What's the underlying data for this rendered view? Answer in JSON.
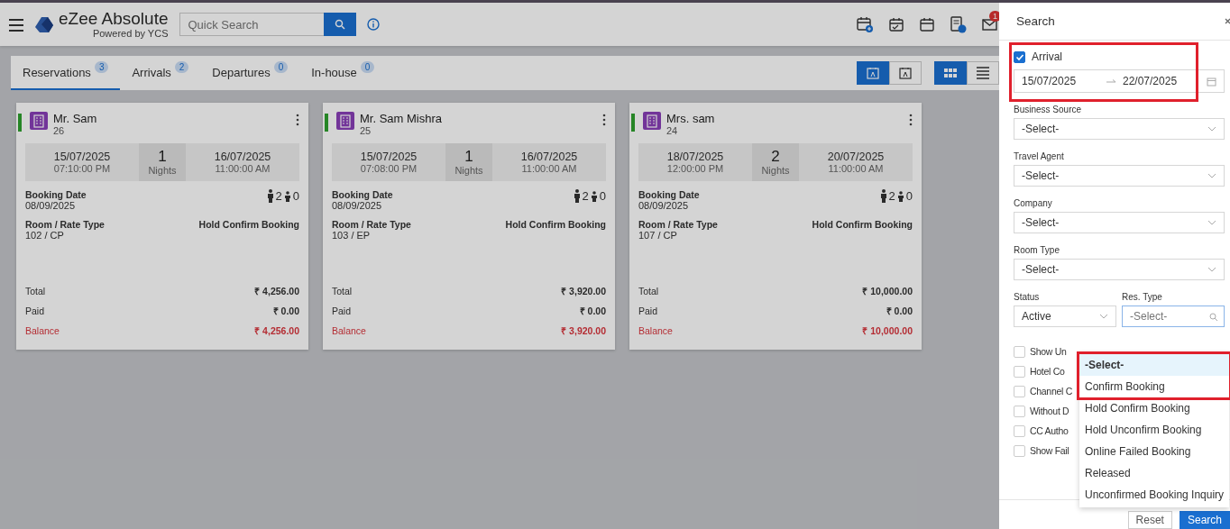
{
  "header": {
    "logo_title": "eZee Absolute",
    "logo_subtitle": "Powered by YCS",
    "search": {
      "placeholder": "Quick Search"
    },
    "mail_badge": "1"
  },
  "tabs": [
    {
      "label": "Reservations",
      "count": "3",
      "selected": true
    },
    {
      "label": "Arrivals",
      "count": "2",
      "selected": false
    },
    {
      "label": "Departures",
      "count": "0",
      "selected": false
    },
    {
      "label": "In-house",
      "count": "0",
      "selected": false
    }
  ],
  "view_modes": [
    {
      "selected": true
    },
    {
      "selected": false
    }
  ],
  "layouts": [
    {
      "selected": true
    },
    {
      "selected": false
    }
  ],
  "cards": [
    {
      "name": "Mr. Sam",
      "number": "26",
      "arrival_date": "15/07/2025",
      "arrival_time": "07:10:00 PM",
      "nights": "1",
      "nights_label": "Nights",
      "departure_date": "16/07/2025",
      "departure_time": "11:00:00 AM",
      "booking_date_label": "Booking Date",
      "booking_date": "08/09/2025",
      "adults": "2",
      "children": "0",
      "room_label": "Room / Rate Type",
      "room": "102 / CP",
      "status": "Hold Confirm Booking",
      "total_label": "Total",
      "total": "₹ 4,256.00",
      "paid_label": "Paid",
      "paid": "₹ 0.00",
      "balance_label": "Balance",
      "balance": "₹ 4,256.00"
    },
    {
      "name": "Mr. Sam Mishra",
      "number": "25",
      "arrival_date": "15/07/2025",
      "arrival_time": "07:08:00 PM",
      "nights": "1",
      "nights_label": "Nights",
      "departure_date": "16/07/2025",
      "departure_time": "11:00:00 AM",
      "booking_date_label": "Booking Date",
      "booking_date": "08/09/2025",
      "adults": "2",
      "children": "0",
      "room_label": "Room / Rate Type",
      "room": "103 / EP",
      "status": "Hold Confirm Booking",
      "total_label": "Total",
      "total": "₹ 3,920.00",
      "paid_label": "Paid",
      "paid": "₹ 0.00",
      "balance_label": "Balance",
      "balance": "₹ 3,920.00"
    },
    {
      "name": "Mrs. sam",
      "number": "24",
      "arrival_date": "18/07/2025",
      "arrival_time": "12:00:00 PM",
      "nights": "2",
      "nights_label": "Nights",
      "departure_date": "20/07/2025",
      "departure_time": "11:00:00 AM",
      "booking_date_label": "Booking Date",
      "booking_date": "08/09/2025",
      "adults": "2",
      "children": "0",
      "room_label": "Room / Rate Type",
      "room": "107 / CP",
      "status": "Hold Confirm Booking",
      "total_label": "Total",
      "total": "₹ 10,000.00",
      "paid_label": "Paid",
      "paid": "₹ 0.00",
      "balance_label": "Balance",
      "balance": "₹ 10,000.00"
    }
  ],
  "search_panel": {
    "title": "Search",
    "arrival": {
      "label": "Arrival",
      "checked": true,
      "from": "15/07/2025",
      "to": "22/07/2025"
    },
    "fields": [
      {
        "label": "Business Source",
        "value": "-Select-"
      },
      {
        "label": "Travel Agent",
        "value": "-Select-"
      },
      {
        "label": "Company",
        "value": "-Select-"
      },
      {
        "label": "Room Type",
        "value": "-Select-"
      }
    ],
    "status": {
      "label": "Status",
      "value": "Active"
    },
    "res_type": {
      "label": "Res. Type",
      "placeholder": "-Select-"
    },
    "options": [
      {
        "label": "-Select-",
        "selected": true
      },
      {
        "label": "Confirm Booking",
        "selected": false
      },
      {
        "label": "Hold Confirm Booking",
        "selected": false
      },
      {
        "label": "Hold Unconfirm Booking",
        "selected": false
      },
      {
        "label": "Online Failed Booking",
        "selected": false
      },
      {
        "label": "Released",
        "selected": false
      },
      {
        "label": "Unconfirmed Booking Inquiry",
        "selected": false
      }
    ],
    "checkboxes": [
      {
        "label": "Show Un",
        "checked": false
      },
      {
        "label": "Hotel Co",
        "checked": false
      },
      {
        "label": "Channel C",
        "checked": false
      },
      {
        "label": "Without D",
        "checked": false
      },
      {
        "label": "CC Autho",
        "checked": false
      },
      {
        "label": "Show Fail",
        "checked": false
      }
    ],
    "buttons": [
      "Reset",
      "Search"
    ]
  }
}
